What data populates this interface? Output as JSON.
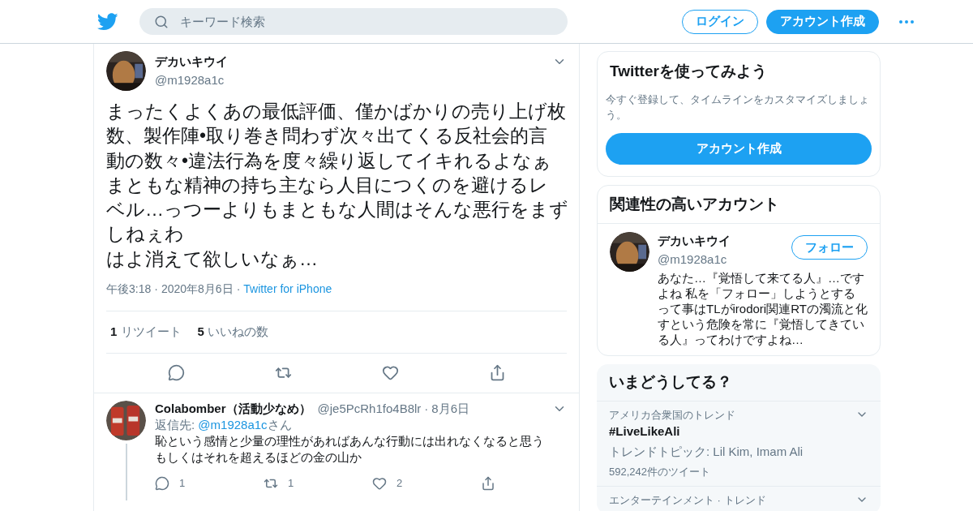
{
  "header": {
    "search": {
      "placeholder": "キーワード検索"
    },
    "buttons": [
      {
        "label": "ログイン",
        "kind": "outline"
      },
      {
        "label": "アカウント作成",
        "kind": "filled"
      }
    ]
  },
  "tweet": {
    "name": "デカいキウイ",
    "handle": "@m1928a1c",
    "text_lines": [
      "まったくよくあの最低評価、僅かばかりの売り上げ枚",
      "数、製作陣•取り巻き問わず次々出てくる反社会的言",
      "動の数々•違法行為を度々繰り返してイキれるよなぁ",
      "まともな精神の持ち主なら人目につくのを避けるレ",
      "ベル…っつーよりもまともな人間はそんな悪行をまず",
      "しねぇわ",
      "はよ消えて欲しいなぁ…"
    ],
    "time": "午後3:18",
    "separator": "·",
    "date": "2020年8月6日",
    "source": "Twitter for iPhone",
    "stats": [
      {
        "count": "1",
        "label": "リツイート"
      },
      {
        "count": "5",
        "label": "いいねの数"
      }
    ]
  },
  "reply": {
    "name": "Colabomber（活動少なめ）",
    "handle": "@je5PcRh1fo4B8lr",
    "separator": "·",
    "date": "8月6日",
    "reply_to_label": "返信先:",
    "reply_to_handle": "@m1928a1c",
    "reply_to_suffix": "さん",
    "text": "恥という感情と少量の理性があればあんな行動には出れなくなると思うもしくはそれを超えるほどの金の山か",
    "counts": [
      "1",
      "1",
      "2"
    ]
  },
  "signup_card": {
    "title": "Twitterを使ってみよう",
    "text": "今すぐ登録して、タイムラインをカスタマイズしましょう。",
    "button": "アカウント作成"
  },
  "related": {
    "title": "関連性の高いアカウント",
    "account": {
      "name": "デカいキウイ",
      "handle": "@m1928a1c",
      "follow": "フォロー",
      "bio": "あなた…『覚悟して来てる人』…ですよね 私を「フォロー」しようとするって事はTLがirodori関連RTの濁流と化すという危険を常に『覚悟してきている人』ってわけですよね…"
    }
  },
  "trends": {
    "title": "いまどうしてる？",
    "items": [
      {
        "context": "アメリカ合衆国のトレンド",
        "name": "#LiveLikeAli",
        "topics": "トレンドトピック: Lil Kim, Imam Ali",
        "count": "592,242件のツイート"
      },
      {
        "context": "エンターテインメント · トレンド"
      }
    ]
  }
}
